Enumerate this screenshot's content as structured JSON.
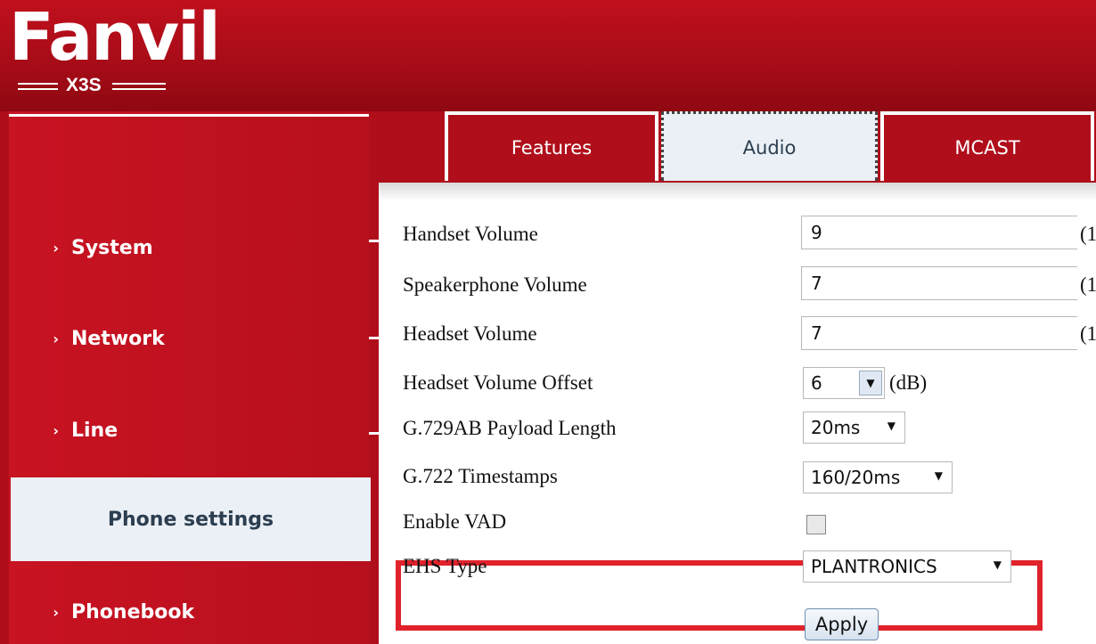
{
  "header": {
    "brand": "Fanvil",
    "model": "X3S"
  },
  "colors": {
    "primary_red": "#b00e1b",
    "active_bg": "#eaf0f5",
    "highlight": "#e0222b"
  },
  "sidebar": {
    "items": [
      {
        "label": "System"
      },
      {
        "label": "Network"
      },
      {
        "label": "Line"
      },
      {
        "label": "Phone settings",
        "active": true
      },
      {
        "label": "Phonebook"
      }
    ]
  },
  "tabs": [
    {
      "label": "Features"
    },
    {
      "label": "Audio",
      "selected": true
    },
    {
      "label": "MCAST"
    }
  ],
  "settings": {
    "handset_volume": {
      "label": "Handset Volume",
      "value": "9",
      "suffix": "(1"
    },
    "speakerphone_volume": {
      "label": "Speakerphone Volume",
      "value": "7",
      "suffix": "(1"
    },
    "headset_volume": {
      "label": "Headset Volume",
      "value": "7",
      "suffix": "(1"
    },
    "headset_volume_offset": {
      "label": "Headset Volume Offset",
      "value": "6",
      "suffix": "(dB)"
    },
    "g729ab_payload_length": {
      "label": "G.729AB Payload Length",
      "value": "20ms"
    },
    "g722_timestamps": {
      "label": "G.722 Timestamps",
      "value": "160/20ms"
    },
    "enable_vad": {
      "label": "Enable VAD",
      "checked": false
    },
    "ehs_type": {
      "label": "EHS Type",
      "value": "PLANTRONICS"
    }
  },
  "apply_label": "Apply"
}
